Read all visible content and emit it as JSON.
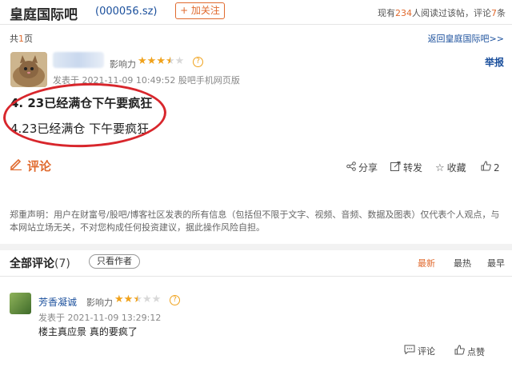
{
  "header": {
    "bar_name": "皇庭国际吧",
    "stock_code": "(000056.sz)",
    "follow_label": "+ 加关注",
    "readers_prefix": "现有",
    "readers_count": "234",
    "readers_mid": "人阅读过该帖，评论",
    "comments_count": "7",
    "readers_suffix": "条"
  },
  "pager": {
    "prefix": "共",
    "pages": "1",
    "suffix": "页",
    "back_link": "返回皇庭国际吧>>"
  },
  "post": {
    "influence_label": "影响力",
    "rating": 3.5,
    "report_label": "举报",
    "meta": "发表于 2021-11-09 10:49:52 股吧手机网页版",
    "line1": "4. 23已经满仓下午要疯狂",
    "line2": "4.23已经满仓 下午要疯狂",
    "annotation_color": "#d8262c"
  },
  "actions": {
    "comment": "评论",
    "share": "分享",
    "forward": "转发",
    "favorite": "收藏",
    "likes": "2"
  },
  "disclaimer": "郑重声明：用户在财富号/股吧/博客社区发表的所有信息（包括但不限于文字、视频、音频、数据及图表）仅代表个人观点，与本网站立场无关，不对您构成任何投资建议，据此操作风险自担。",
  "comments_section": {
    "title": "全部评论",
    "count": "(7)",
    "only_author": "只看作者",
    "sort_newest": "最新",
    "sort_hottest": "最热",
    "sort_earliest": "最早"
  },
  "comment": {
    "name": "芳香凝诚",
    "influence_label": "影响力",
    "rating": 2.5,
    "meta": "发表于 2021-11-09 13:29:12",
    "text": "楼主真应景 真的要疯了",
    "reply_label": "评论",
    "like_label": "点赞"
  },
  "colors": {
    "accent": "#e06a2e",
    "link": "#1a4f9c",
    "star": "#f0a21c"
  }
}
